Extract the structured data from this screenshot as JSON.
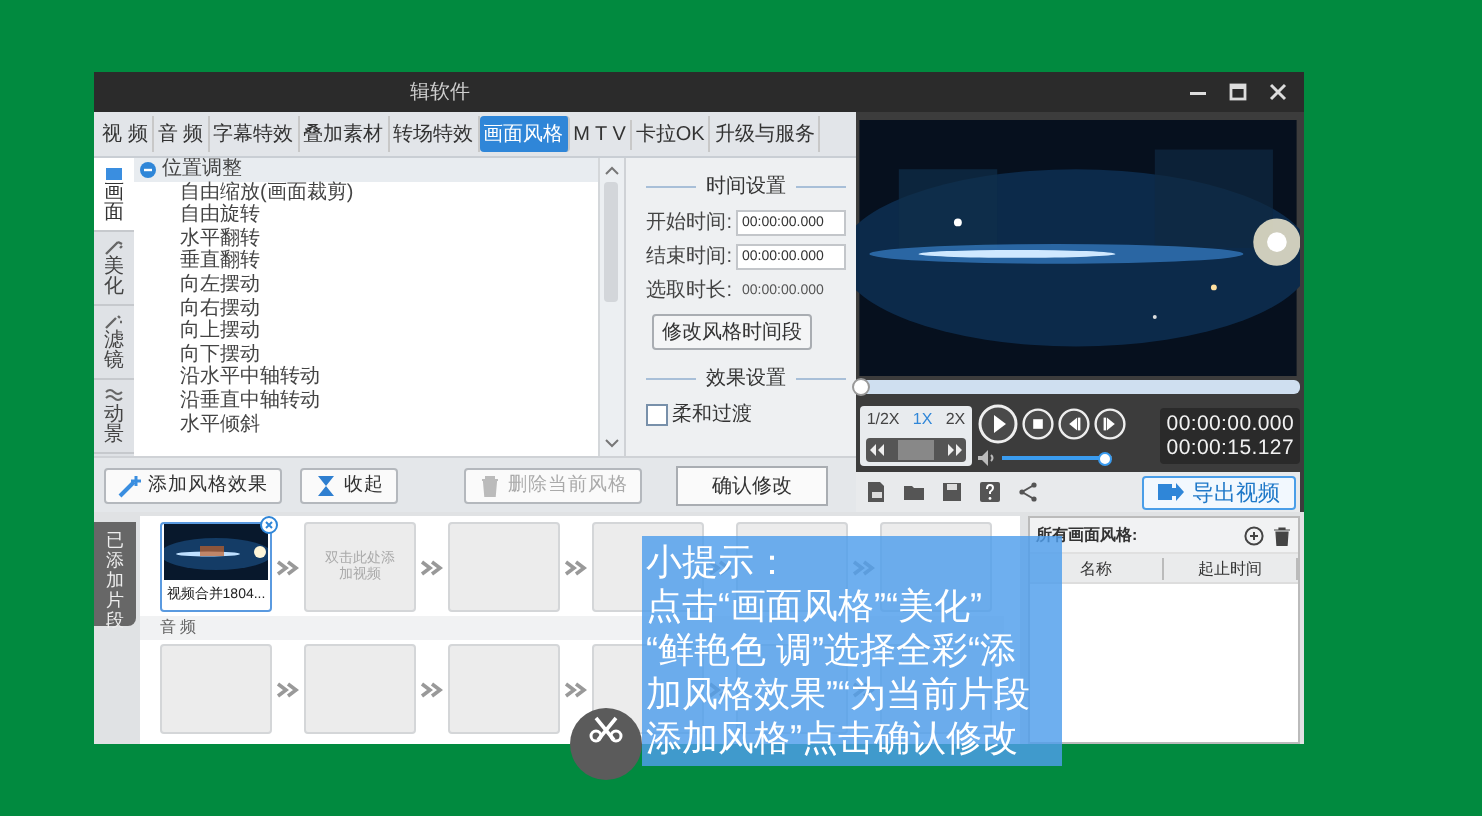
{
  "window": {
    "title": "辑软件"
  },
  "tabs": [
    {
      "label": "视 频",
      "selected": false
    },
    {
      "label": "音 频",
      "selected": false
    },
    {
      "label": "字幕特效",
      "selected": false
    },
    {
      "label": "叠加素材",
      "selected": false
    },
    {
      "label": "转场特效",
      "selected": false
    },
    {
      "label": "画面风格",
      "selected": true
    },
    {
      "label": "M T V",
      "selected": false
    },
    {
      "label": "卡拉OK",
      "selected": false
    },
    {
      "label": "升级与服务",
      "selected": false
    }
  ],
  "side_tabs": [
    {
      "label": "画面",
      "selected": true
    },
    {
      "label": "美化",
      "selected": false
    },
    {
      "label": "滤镜",
      "selected": false
    },
    {
      "label": "动景",
      "selected": false
    }
  ],
  "effect_tree": [
    {
      "label": "位置调整",
      "expanded": true,
      "children": [
        {
          "label": "自由缩放(画面裁剪)"
        },
        {
          "label": "自由旋转"
        },
        {
          "label": "水平翻转"
        },
        {
          "label": "垂直翻转"
        },
        {
          "label": "向左摆动"
        },
        {
          "label": "向右摆动"
        },
        {
          "label": "向上摆动"
        },
        {
          "label": "向下摆动"
        },
        {
          "label": "沿水平中轴转动"
        },
        {
          "label": "沿垂直中轴转动"
        },
        {
          "label": "水平倾斜"
        }
      ]
    }
  ],
  "time_settings": {
    "heading": "时间设置",
    "fields": [
      {
        "kind": "input",
        "label": "开始时间:",
        "value": "00:00:00.000"
      },
      {
        "kind": "input",
        "label": "结束时间:",
        "value": "00:00:00.000"
      },
      {
        "kind": "text",
        "label": "选取时长:",
        "value": "00:00:00.000"
      }
    ],
    "button": "修改风格时间段"
  },
  "effect_settings": {
    "heading": "效果设置",
    "options": [
      {
        "label": "柔和过渡",
        "checked": false
      }
    ]
  },
  "left_buttons": [
    {
      "label": "添加风格效果",
      "disabled": false
    },
    {
      "label": "收起",
      "disabled": false
    },
    {
      "label": "删除当前风格",
      "disabled": true
    }
  ],
  "confirm_button": "确认修改",
  "player": {
    "progress": {
      "level": 0
    },
    "jog": {
      "level": 0.5
    },
    "speeds": [
      {
        "label": "1/2X",
        "selected": false
      },
      {
        "label": "1X",
        "selected": true
      },
      {
        "label": "2X",
        "selected": false
      }
    ],
    "volume": {
      "level": 0.95
    },
    "current_time": "00:00:00.000",
    "total_time": "00:00:15.127"
  },
  "export_button": "导出视频",
  "timeline": {
    "tab": "已添加片段",
    "video_clips": [
      {
        "kind": "clip",
        "label": "视频合并1804..."
      },
      {
        "kind": "hint",
        "label": "双击此处添加视频"
      },
      {
        "kind": "empty"
      },
      {
        "kind": "empty"
      },
      {
        "kind": "empty"
      },
      {
        "kind": "empty"
      }
    ],
    "audio_label": "音 频",
    "audio_clips": [
      {
        "kind": "empty"
      },
      {
        "kind": "empty"
      },
      {
        "kind": "empty"
      },
      {
        "kind": "empty"
      },
      {
        "kind": "empty"
      },
      {
        "kind": "empty"
      }
    ]
  },
  "styles_panel": {
    "title": "所有画面风格:",
    "columns": [
      "名称",
      "起止时间"
    ]
  },
  "caption": {
    "lines": [
      "小提示：",
      "点击“画面风格”“美化”",
      "“鲜艳色 调”选择全彩“添",
      "加风格效果”“为当前片段",
      "添加风格”点击确认修改"
    ]
  }
}
